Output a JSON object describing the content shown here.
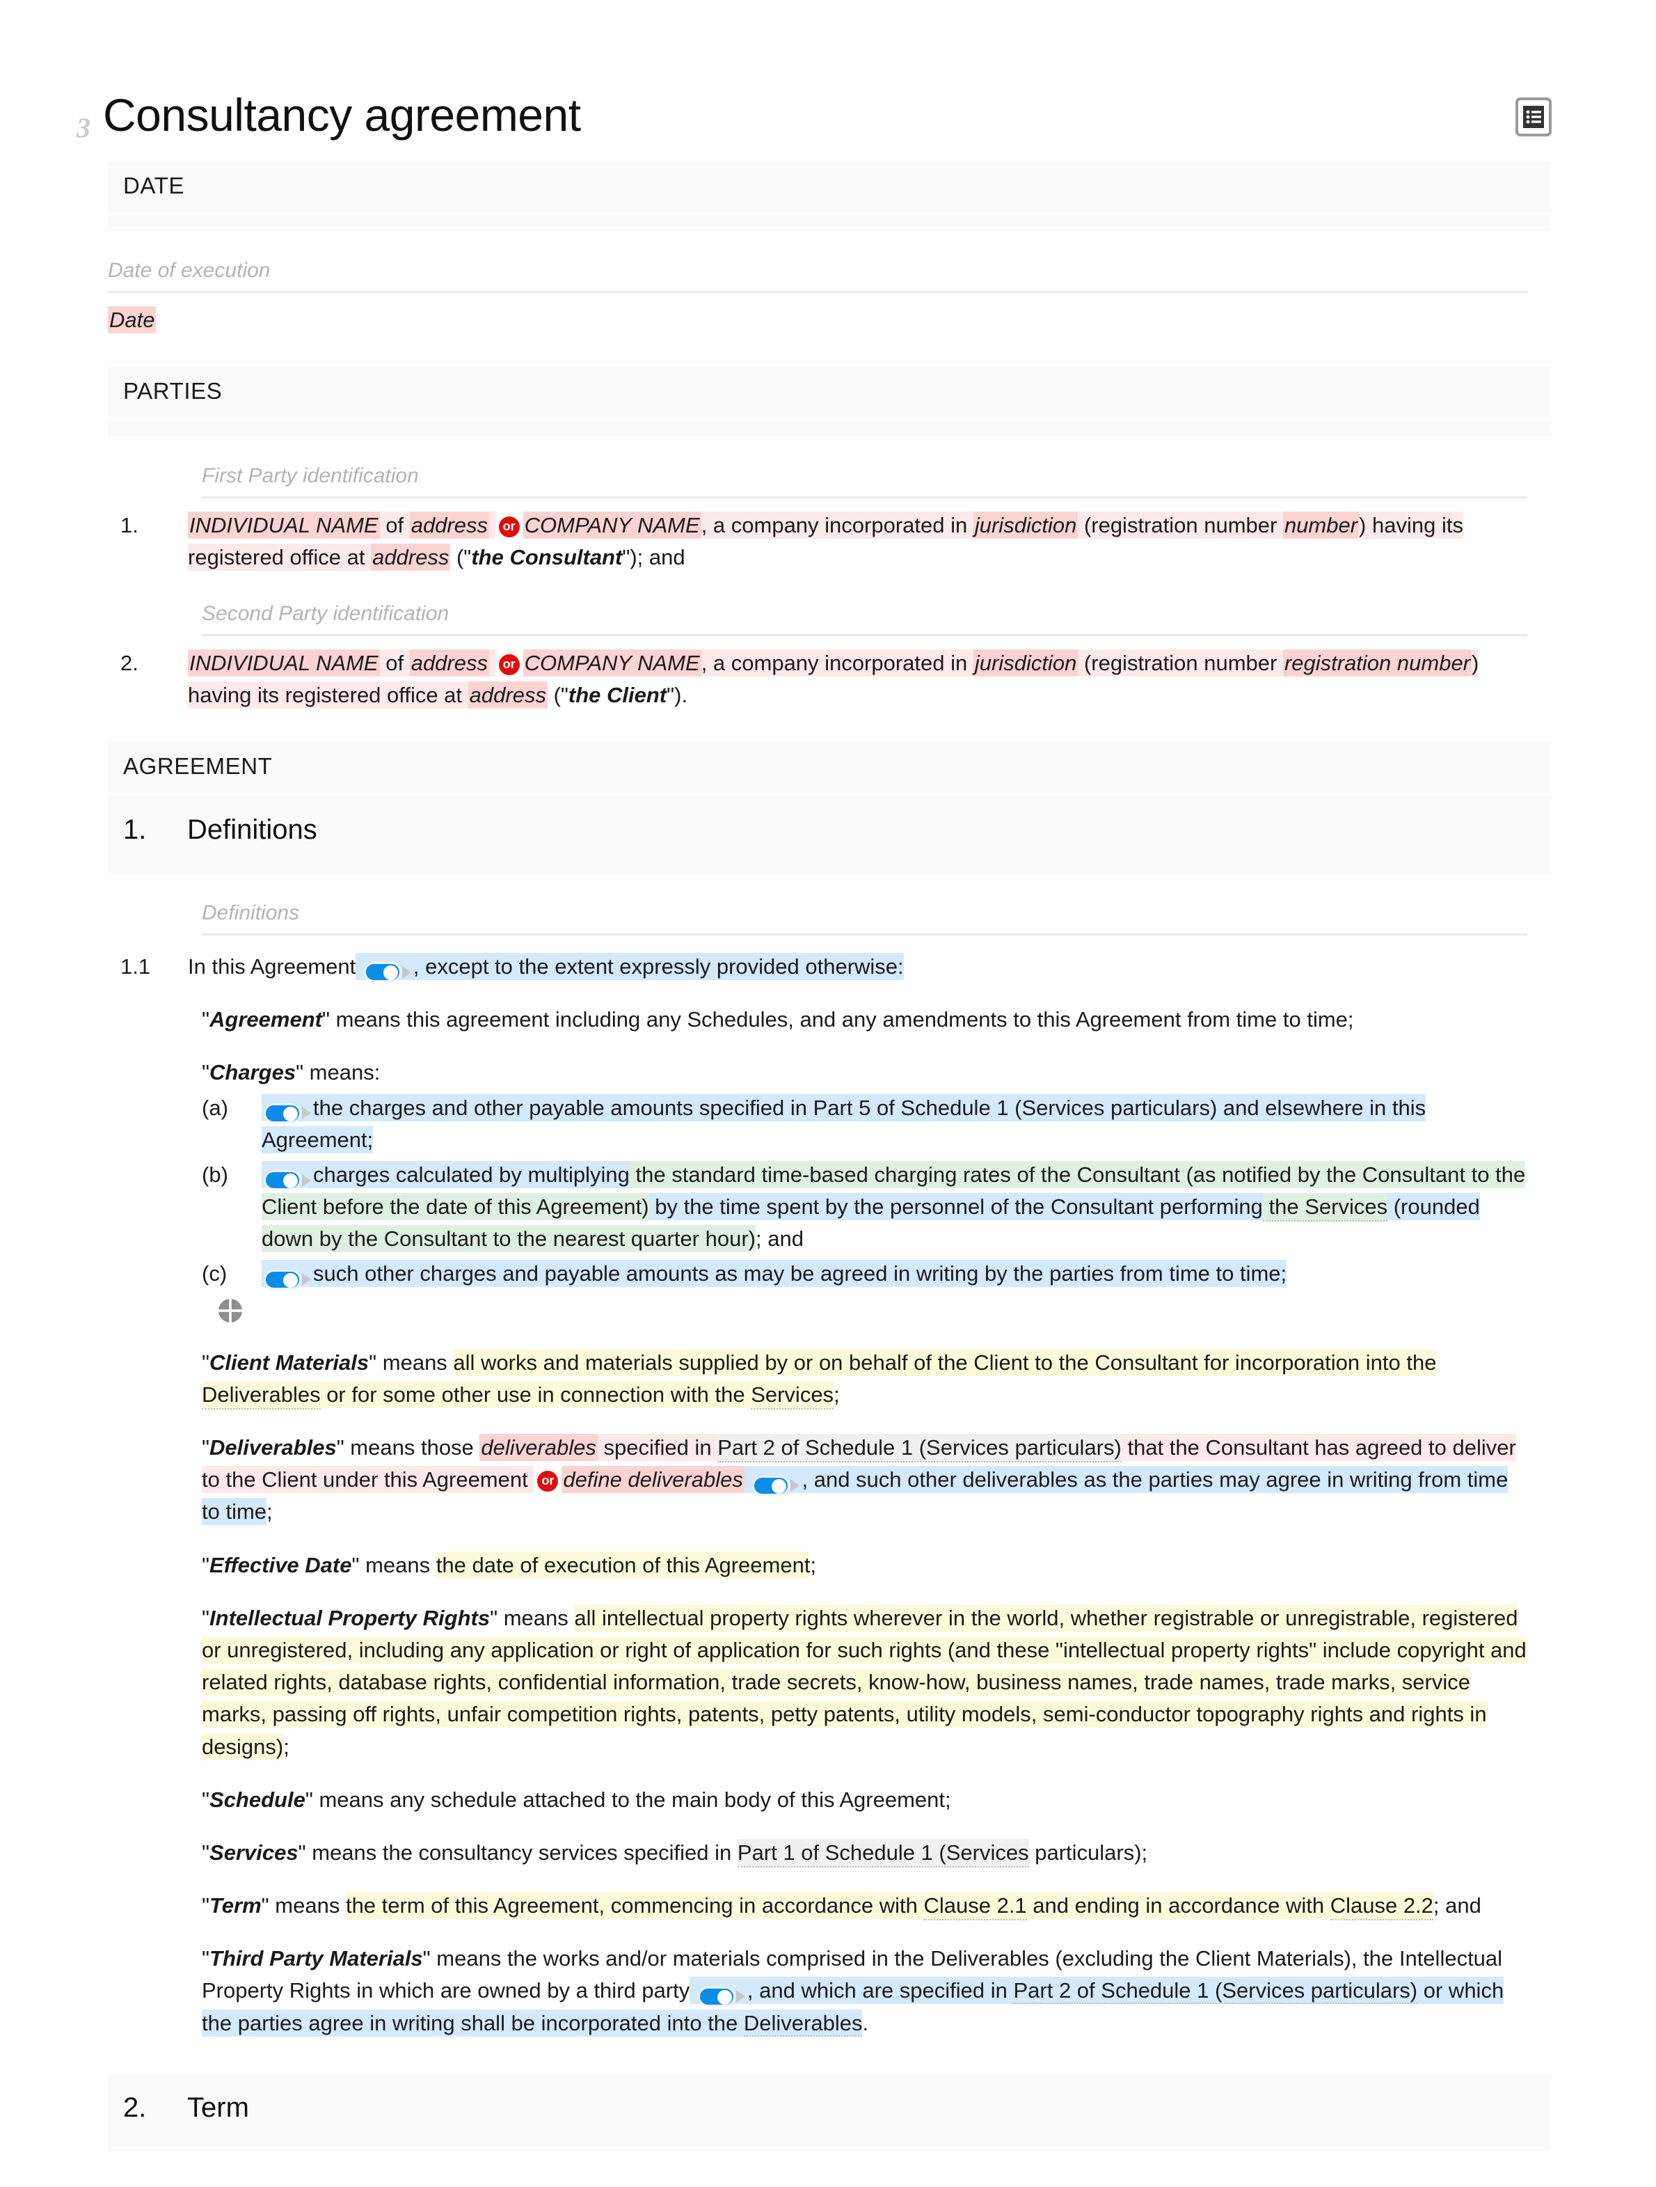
{
  "document": {
    "badge": "3",
    "title": "Consultancy agreement",
    "outline_icon": "outline-list-icon"
  },
  "sections": {
    "date": {
      "heading": "DATE",
      "guidance": "Date of execution",
      "value": "Date"
    },
    "parties": {
      "heading": "PARTIES",
      "first_guidance": "First Party identification",
      "second_guidance": "Second Party identification",
      "party1": {
        "number": "1.",
        "individual_name": "INDIVIDUAL NAME",
        "of": " of ",
        "address": "address",
        "or_badge": "or",
        "company_name": "COMPANY NAME",
        "mid1": ", a company incorporated in ",
        "jurisdiction": "jurisdiction",
        "mid2": " (registration number ",
        "number_ph": "number",
        "mid3": ") having its registered office at ",
        "address2": "address",
        "mid4": " (\"",
        "defined_term": "the Consultant",
        "tail": "\"); and"
      },
      "party2": {
        "number": "2.",
        "individual_name": "INDIVIDUAL NAME",
        "of": " of ",
        "address": "address",
        "or_badge": "or",
        "company_name": "COMPANY NAME",
        "mid1": ", a company incorporated in ",
        "jurisdiction": "jurisdiction",
        "mid2": " (registration number ",
        "number_ph": "registration number",
        "mid3": ") having its registered office at ",
        "address2": "address",
        "mid4": " (\"",
        "defined_term": "the Client",
        "tail": "\")."
      }
    },
    "agreement": {
      "heading": "AGREEMENT",
      "clause1": {
        "number": "1.",
        "title": "Definitions",
        "guidance": "Definitions",
        "lead": {
          "number": "1.1",
          "before": "In this Agreement",
          "after": ", except to the extent expressly provided otherwise:"
        },
        "definitions": [
          {
            "term": "Agreement",
            "text": "\" means this agreement including any Schedules, and any amendments to this Agreement from time to time;"
          }
        ],
        "charges": {
          "term": "Charges",
          "lead": "\" means:",
          "items": [
            {
              "marker": "(a)",
              "text": "the charges and other payable amounts specified in Part 5 of Schedule 1 (Services particulars) and elsewhere in this Agreement;"
            },
            {
              "marker": "(b)",
              "part1": "charges calculated by multiplying",
              "part2": " the standard time-based charging rates of the Consultant (as notified by the Consultant to the Client before the date of this Agreement)",
              "part3": " by the time spent by the personnel of the Consultant performing",
              "part4": " the Services",
              "part5": " (rounded",
              "part6": " down by the Consultant to the nearest quarter hour)",
              "part7": "; and"
            },
            {
              "marker": "(c)",
              "text": "such other charges and payable amounts as may be agreed in writing by the parties from time to time;"
            }
          ],
          "drag_handle": "drag-handle-icon"
        },
        "client_materials": {
          "term": "Client Materials",
          "before": "\" means ",
          "h1": "all works and materials supplied by or on behalf of the Client to the Consultant for incorporation into the ",
          "x1": "Deliverables",
          "h2": " or for some other use in connection with the ",
          "x2": "Services",
          "tail": ";"
        },
        "deliverables": {
          "term": "Deliverables",
          "before": "\" means those ",
          "ph1": "deliverables",
          "mid1": " specified in ",
          "xref1": "Part 2 of Schedule 1 (Services particulars)",
          "mid2": " that the Consultant has agreed to deliver to the Client under this Agreement ",
          "or_badge": "or",
          "ph2": "define deliverables",
          "mid3": ", and such other deliverables as the parties may agree in writing from time to time",
          "tail": ";"
        },
        "effective_date": {
          "term": "Effective Date",
          "before": "\" means ",
          "highlight": "the date of execution of this Agreement",
          "tail": ";"
        },
        "ipr": {
          "term": "Intellectual Property Rights",
          "before": "\" means ",
          "highlight": "all intellectual property rights wherever in the world, whether registrable or unregistrable, registered or unregistered, including any application or right of application for such rights (and these \"intellectual property rights\" include copyright and related rights, database rights, confidential information, trade secrets, know-how, business names, trade names, trade marks, service marks, passing off rights, unfair competition rights, patents, petty patents, utility models, semi-conductor topography rights and rights in designs)",
          "tail": ";"
        },
        "schedule": {
          "term": "Schedule",
          "text": "\" means any schedule attached to the main body of this Agreement;"
        },
        "services": {
          "term": "Services",
          "before": "\" means the consultancy services specified in ",
          "xref": "Part 1 of Schedule 1 (Services",
          "after": " particulars);"
        },
        "term_def": {
          "term": "Term",
          "before": "\" means ",
          "h1": "the term of this Agreement, commencing in accordance with ",
          "x1": "Clause 2.1",
          "h2": " and ending in accordance with ",
          "x2": "Clause 2.2",
          "tail": "; and"
        },
        "third_party_materials": {
          "term": "Third Party Materials",
          "before": "\" means the works and/or materials comprised in the Deliverables (excluding the Client Materials), the Intellectual Property Rights in which are owned by a third party",
          "mid": ", and which are specified in ",
          "xref": "Part 2 of Schedule 1 (Services particulars)",
          "after": " or which the parties agree in writing shall be incorporated into the ",
          "x2": "Deliverables",
          "tail": "."
        }
      },
      "clause2": {
        "number": "2.",
        "title": "Term"
      }
    }
  }
}
